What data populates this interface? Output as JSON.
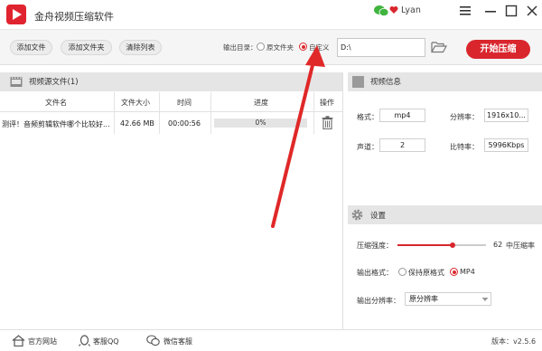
{
  "app": {
    "title": "金舟视频压缩软件",
    "user": "Lyan",
    "version_label": "版本：",
    "version": "v2.5.6"
  },
  "toolbar": {
    "add_file": "添加文件",
    "add_folder": "添加文件夹",
    "clear_list": "清除列表",
    "output_dir_label": "输出目录：",
    "radio_original": "原文件夹",
    "radio_custom": "自定义",
    "output_path": "D:\\",
    "start": "开始压缩"
  },
  "file_panel": {
    "title": "视频源文件(1)",
    "columns": [
      "文件名",
      "文件大小",
      "时间",
      "进度",
      "操作"
    ],
    "rows": [
      {
        "name": "测评！音频剪辑软件哪个比较好...",
        "size": "42.66 MB",
        "time": "00:00:56",
        "progress_text": "0%",
        "progress": 0
      }
    ]
  },
  "video_info": {
    "title": "视频信息",
    "format_label": "格式：",
    "format": "mp4",
    "resolution_label": "分辨率：",
    "resolution": "1916x10...",
    "channels_label": "声道：",
    "channels": "2",
    "bitrate_label": "比特率：",
    "bitrate": "5996Kbps"
  },
  "settings": {
    "title": "设置",
    "strength_label": "压缩强度：",
    "strength": 62,
    "strength_text": "中压缩率",
    "out_format_label": "输出格式：",
    "keep_format": "保持原格式",
    "mp4": "MP4",
    "out_res_label": "输出分辨率：",
    "out_res": "原分辨率"
  },
  "footer": {
    "website": "官方网站",
    "qq": "客服QQ",
    "wechat": "微信客服"
  },
  "colors": {
    "accent": "#d9262d",
    "panel_header": "#e5e5e5",
    "toolbar_bg": "#f5f5f5"
  }
}
